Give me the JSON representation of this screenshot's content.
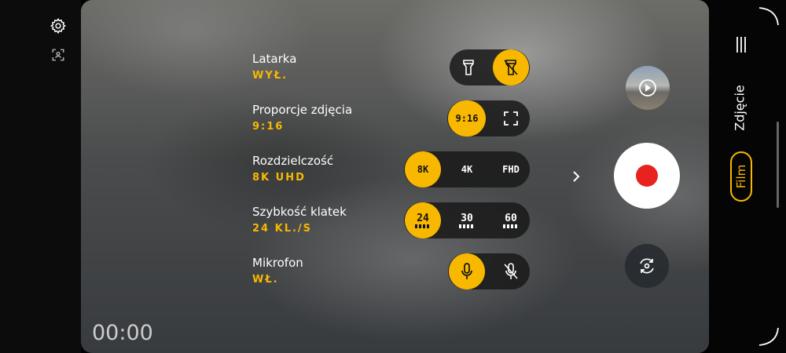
{
  "side_icons": {
    "settings": "gear-icon",
    "focus": "focus-frame-icon"
  },
  "timer": "00:00",
  "settings": [
    {
      "label": "Latarka",
      "value": "WYŁ."
    },
    {
      "label": "Proporcje zdjęcia",
      "value": "9:16"
    },
    {
      "label": "Rozdzielczość",
      "value": "8K UHD"
    },
    {
      "label": "Szybkość klatek",
      "value": "24 KL./S"
    },
    {
      "label": "Mikrofon",
      "value": "WŁ."
    }
  ],
  "options": {
    "ratio": {
      "a": "9:16"
    },
    "resolution": {
      "a": "8K",
      "b": "4K",
      "c": "FHD"
    },
    "fps": {
      "a": "24",
      "b": "30",
      "c": "60"
    }
  },
  "modes": {
    "photo": "Zdjęcie",
    "film": "Film"
  },
  "colors": {
    "accent": "#f8b800",
    "record": "#e8231f"
  }
}
